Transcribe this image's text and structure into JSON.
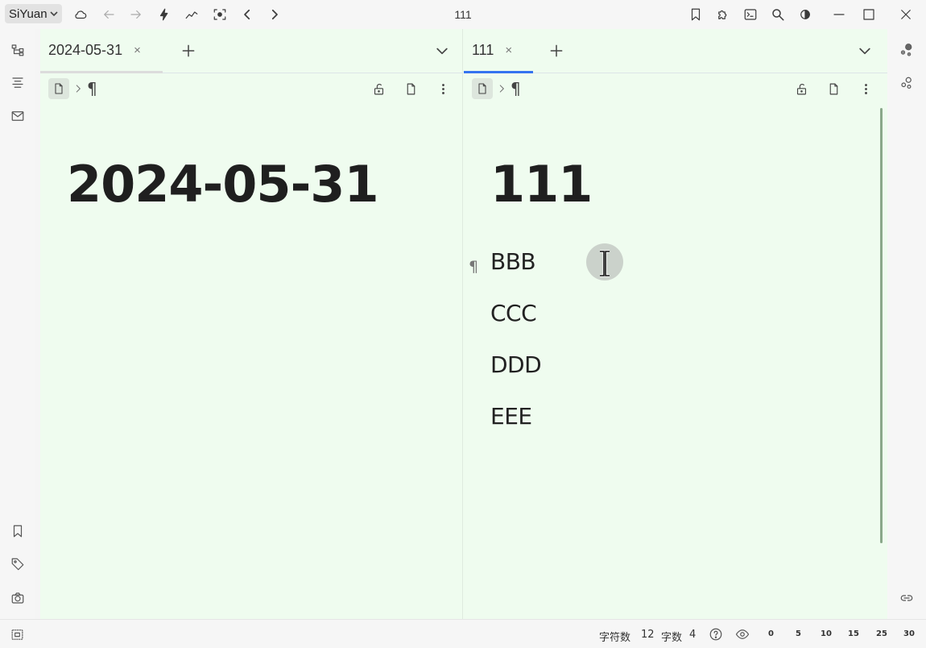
{
  "topbar": {
    "workspace": "SiYuan",
    "title": "111",
    "icons": [
      "cloud-icon",
      "back-icon",
      "forward-icon",
      "lightning-icon",
      "graph-icon",
      "focus-icon",
      "chevron-left-icon",
      "chevron-right-icon",
      "bookmark-icon",
      "puzzle-icon",
      "terminal-icon",
      "search-icon",
      "theme-icon",
      "minimize-icon",
      "maximize-icon",
      "close-icon"
    ]
  },
  "left_pane": {
    "tab_label": "2024-05-31",
    "tab_close": "×",
    "breadcrumb_para": "¶",
    "doc_title": "2024-05-31"
  },
  "right_pane": {
    "tab_label": "111",
    "tab_close": "×",
    "breadcrumb_para": "¶",
    "doc_title": "111",
    "gutter_para": "¶",
    "blocks": [
      "BBB",
      "CCC",
      "DDD",
      "EEE"
    ]
  },
  "statusbar": {
    "char_count_label": "字符数",
    "char_count": "12",
    "word_count_label": "字数",
    "word_count": "4",
    "zoom_marks": [
      "0",
      "5",
      "10",
      "15",
      "25",
      "30"
    ]
  },
  "colors": {
    "editor_bg": "#effcef",
    "active_tab": "#3573f0"
  }
}
